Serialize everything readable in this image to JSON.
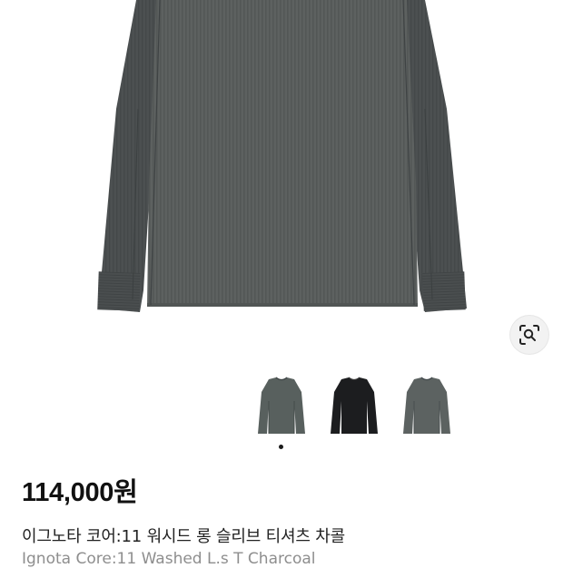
{
  "product": {
    "price": "114,000원",
    "name_ko": "이그노타 코어:11 워시드 롱 슬리브 티셔츠 차콜",
    "name_en": "Ignota Core:11 Washed L.s T Charcoal"
  },
  "gallery": {
    "thumbnails": [
      {
        "name": "charcoal-front",
        "color": "#55595a"
      },
      {
        "name": "black-front",
        "color": "#1c1d1f"
      },
      {
        "name": "charcoal-alt",
        "color": "#55595a"
      }
    ],
    "active_index": 0
  },
  "icons": {
    "lens": "image-search-icon"
  },
  "colors": {
    "garment_body": "#5d6160",
    "garment_side_panel": "#4a4e4f",
    "price_text": "#111111",
    "subtitle_text": "#8e8e8e"
  }
}
